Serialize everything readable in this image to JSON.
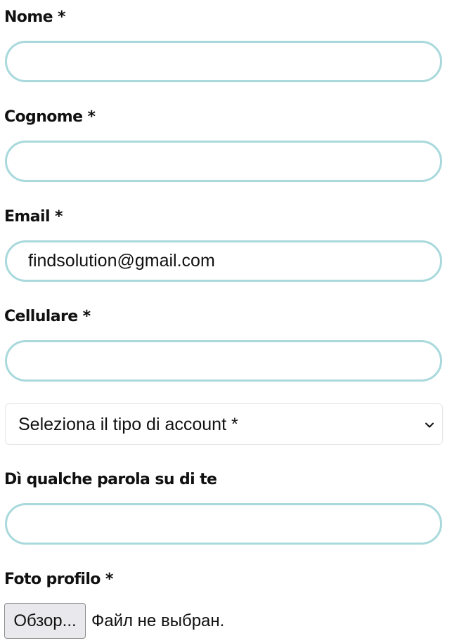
{
  "form": {
    "nome": {
      "label": "Nome *",
      "value": ""
    },
    "cognome": {
      "label": "Cognome *",
      "value": ""
    },
    "email": {
      "label": "Email *",
      "value": "findsolution@gmail.com"
    },
    "cellulare": {
      "label": "Cellulare *",
      "value": ""
    },
    "account_type": {
      "selected": "Seleziona il tipo di account *"
    },
    "bio": {
      "label": "Dì qualche parola su di te",
      "value": ""
    },
    "photo": {
      "label": "Foto profilo *",
      "button_label": "Обзор...",
      "status": "Файл не выбран."
    }
  },
  "colors": {
    "input_border": "#a9d9dc",
    "select_border": "#e6e6e6",
    "text": "#111111",
    "button_bg": "#e9e9ed"
  },
  "icons": {
    "select_chevron": "chevron-down-icon"
  }
}
